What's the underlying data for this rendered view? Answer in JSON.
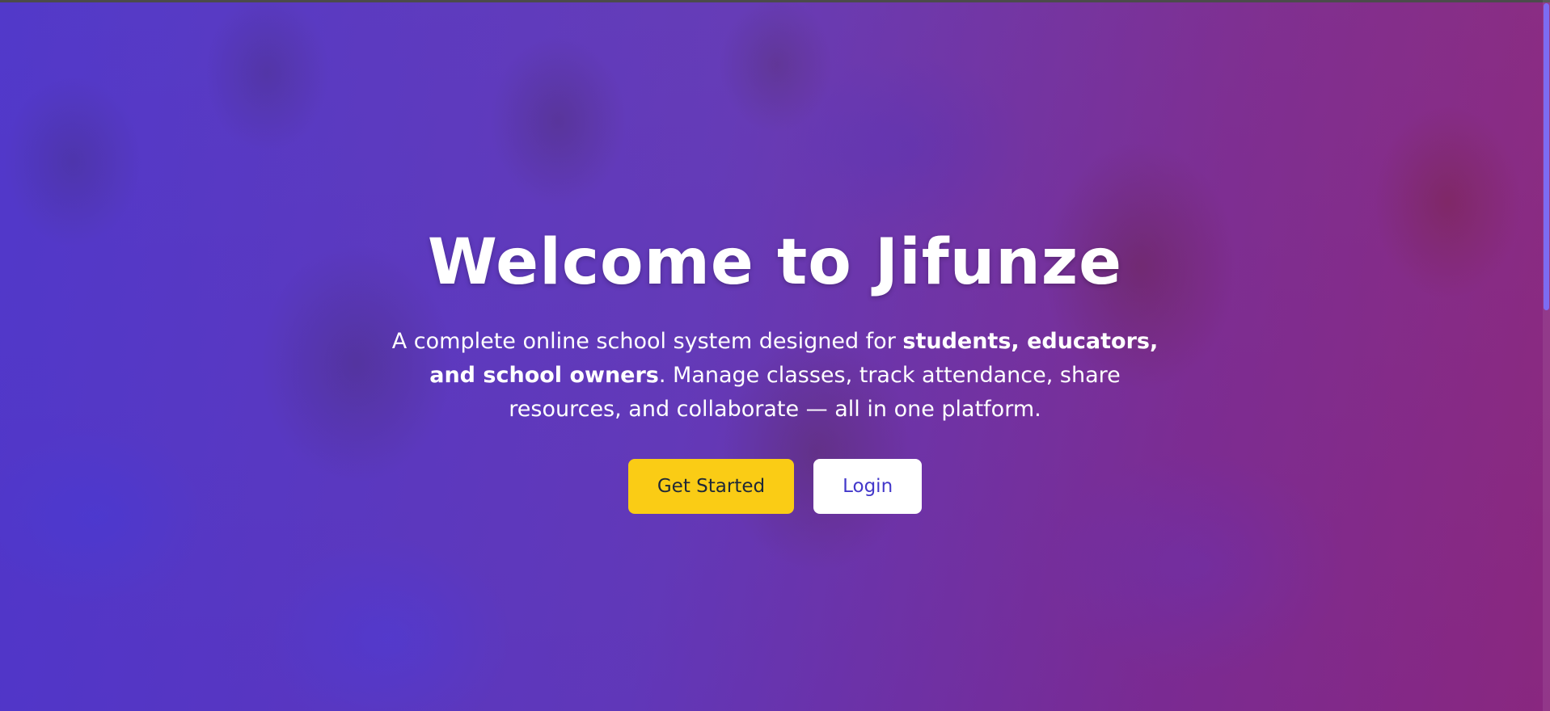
{
  "hero": {
    "title": "Welcome to Jifunze",
    "description_part1": "A complete online school system designed for ",
    "description_bold": "students, educators, and school owners",
    "description_part2": ". Manage classes, track attendance, share resources, and collaborate — all in one platform.",
    "primary_button": "Get Started",
    "secondary_button": "Login"
  },
  "colors": {
    "overlay_start": "#4f38dc",
    "overlay_end": "#aa236e",
    "primary_button_bg": "#facc15",
    "secondary_button_bg": "#ffffff",
    "secondary_button_text": "#4338ca",
    "scrollbar_thumb": "#7c6cf2"
  }
}
